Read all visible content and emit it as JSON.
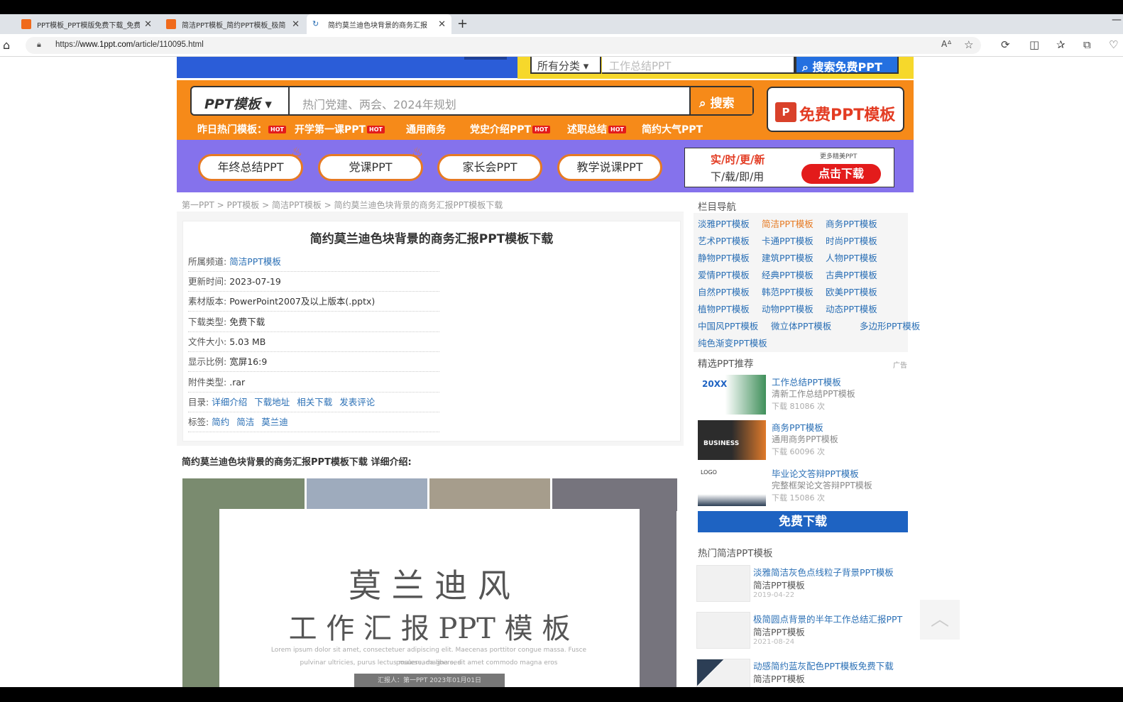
{
  "browser": {
    "tabs": [
      {
        "title": "PPT模板_PPT模版免费下载_免费"
      },
      {
        "title": "简洁PPT模板_简约PPT模板_极简"
      },
      {
        "title": "简约莫兰迪色块背景的商务汇报"
      }
    ],
    "new_tab": "+",
    "url_prefix": "https://",
    "url_host": "www.1ppt.com",
    "url_path": "/article/110095.html"
  },
  "top_search": {
    "category": "所有分类 ▾",
    "placeholder": "工作总结PPT",
    "button": "搜索免费PPT"
  },
  "search": {
    "category": "PPT模板 ▾",
    "placeholder": "热门党建、两会、2024年规划",
    "button": "搜索"
  },
  "free_button": {
    "icon": "P",
    "label": "免费PPT模板"
  },
  "hot_row": {
    "lead": "昨日热门模板：",
    "items": [
      "开学第一课PPT",
      "通用商务",
      "党史介绍PPT",
      "述职总结",
      "简约大气PPT"
    ],
    "hot_badge": "HOT"
  },
  "pills": [
    "年终总结PPT",
    "党课PPT",
    "家长会PPT",
    "教学说课PPT"
  ],
  "promo": {
    "line1": "实/时/更/新",
    "line2": "下/载/即/用",
    "more": "更多精美PPT",
    "button": "点击下载"
  },
  "breadcrumb": "第一PPT > PPT模板 > 简洁PPT模板 > 简约莫兰迪色块背景的商务汇报PPT模板下载",
  "article": {
    "title": "简约莫兰迪色块背景的商务汇报PPT模板下载",
    "channel_label": "所属频道:",
    "channel_value": "简洁PPT模板",
    "updated_label": "更新时间:",
    "updated_value": "2023-07-19",
    "version_label": "素材版本:",
    "version_value": "PowerPoint2007及以上版本(.pptx)",
    "dltype_label": "下载类型:",
    "dltype_value": "免费下载",
    "size_label": "文件大小:",
    "size_value": "5.03 MB",
    "ratio_label": "显示比例:",
    "ratio_value": "宽屏16:9",
    "attach_label": "附件类型:",
    "attach_value": ".rar",
    "toc_label": "目录:",
    "toc": [
      "详细介绍",
      "下载地址",
      "相关下载",
      "发表评论"
    ],
    "tags_label": "标签:",
    "tags": [
      "简约",
      "简洁",
      "莫兰迪"
    ]
  },
  "intro_title": "简约莫兰迪色块背景的商务汇报PPT模板下载 详细介绍:",
  "preview": {
    "line1": "莫 兰 迪 风",
    "line2": "工 作 汇 报 PPT 模 板",
    "lorem1": "Lorem ipsum dolor sit amet, consectetuer adipiscing elit. Maecenas porttitor congue massa. Fusce posuere, magna sed",
    "lorem2": "pulvinar ultricies, purus lectus malesuada libero, sit amet commodo magna eros",
    "bar": "汇报人：第一PPT  2023年01月01日",
    "colors": [
      "#7a8b6f",
      "#9eabbd",
      "#a69d8c",
      "#76747d"
    ]
  },
  "sidebar": {
    "nav_title": "栏目导航",
    "nav": [
      [
        "淡雅PPT模板",
        "简洁PPT模板",
        "商务PPT模板"
      ],
      [
        "艺术PPT模板",
        "卡通PPT模板",
        "时尚PPT模板"
      ],
      [
        "静物PPT模板",
        "建筑PPT模板",
        "人物PPT模板"
      ],
      [
        "爱情PPT模板",
        "经典PPT模板",
        "古典PPT模板"
      ],
      [
        "自然PPT模板",
        "韩范PPT模板",
        "欧美PPT模板"
      ],
      [
        "植物PPT模板",
        "动物PPT模板",
        "动态PPT模板"
      ],
      [
        "中国风PPT模板",
        "微立体PPT模板",
        "多边形PPT模板"
      ],
      [
        "纯色渐变PPT模板"
      ]
    ],
    "rec_title": "精选PPT推荐",
    "ad_label": "广告",
    "rec": [
      {
        "title": "工作总结PPT模板",
        "sub": "清新工作总结PPT模板",
        "count": "下载 81086 次",
        "thumb_text": "20XX"
      },
      {
        "title": "商务PPT模板",
        "sub": "通用商务PPT模板",
        "count": "下载 60096 次",
        "thumb_text": "BUSINESS"
      },
      {
        "title": "毕业论文答辩PPT模板",
        "sub": "完整框架论文答辩PPT模板",
        "count": "下载 15086 次",
        "thumb_text": "LOGO"
      }
    ],
    "free_dl": "免费下载",
    "hot_title": "热门简洁PPT模板",
    "hot": [
      {
        "title": "淡雅简洁灰色点线粒子背景PPT模板",
        "sub": "简洁PPT模板",
        "date": "2019-04-22"
      },
      {
        "title": "极简圆点背景的半年工作总结汇报PPT",
        "sub": "简洁PPT模板",
        "date": "2021-08-24"
      },
      {
        "title": "动感简约蓝灰配色PPT模板免费下载",
        "sub": "简洁PPT模板",
        "date": ""
      }
    ]
  },
  "colors": {
    "orange": "#f68a19",
    "purple": "#8572ec",
    "link": "#2a6fb5",
    "red": "#e31b1b"
  }
}
